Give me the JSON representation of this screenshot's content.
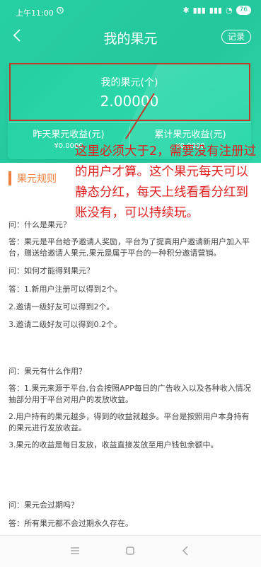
{
  "status": {
    "time": "上午11:00",
    "battery": "76"
  },
  "header": {
    "title": "我的果元",
    "record_button": "记录"
  },
  "card": {
    "label": "我的果元(个)",
    "value": "2.00000",
    "yesterday_label": "昨天果元收益(元)",
    "yesterday_value": "¥0.0000",
    "total_label": "累计果元收益(元)",
    "total_value": "¥0.0000"
  },
  "annotation": "这里必须大于2，需要没有注册过的用户才算。这个果元每天可以静态分红，每天上线看看分红到账没有，可以持续玩。",
  "section": {
    "title": "果元规则"
  },
  "faq": [
    {
      "q": "问：什么是果元？",
      "a": [
        "答：果元是平台给予邀请人奖励，平台为了提高用户邀请新用户加入平台，赠送给邀请人果元,果元是属于平台的一种积分邀请营销。"
      ]
    },
    {
      "q": "问：如何才能得到果元？",
      "a": [
        "答：1.新用户注册可以得到2个。",
        "2.邀请一级好友可以得到2个。",
        "3.邀请二级好友可以得到0.2个。"
      ]
    },
    {
      "q": "问：果元有什么作用？",
      "a": [
        "答：1.果元来源于平台,台会按照APP每日的广告收入以及各种收入情况抽部分用于平台对用户的发放收益。",
        "2.用户持有的果元越多，得到的收益就越多。平台是按照用户本身持有的果元进行发放收益。",
        "3.果元的收益是每日发放，收益直接发放至用户钱包余额中。"
      ]
    },
    {
      "q": "问：果元会过期吗？",
      "a": [
        "答：所有果元都不会过期永久存在。"
      ]
    }
  ]
}
